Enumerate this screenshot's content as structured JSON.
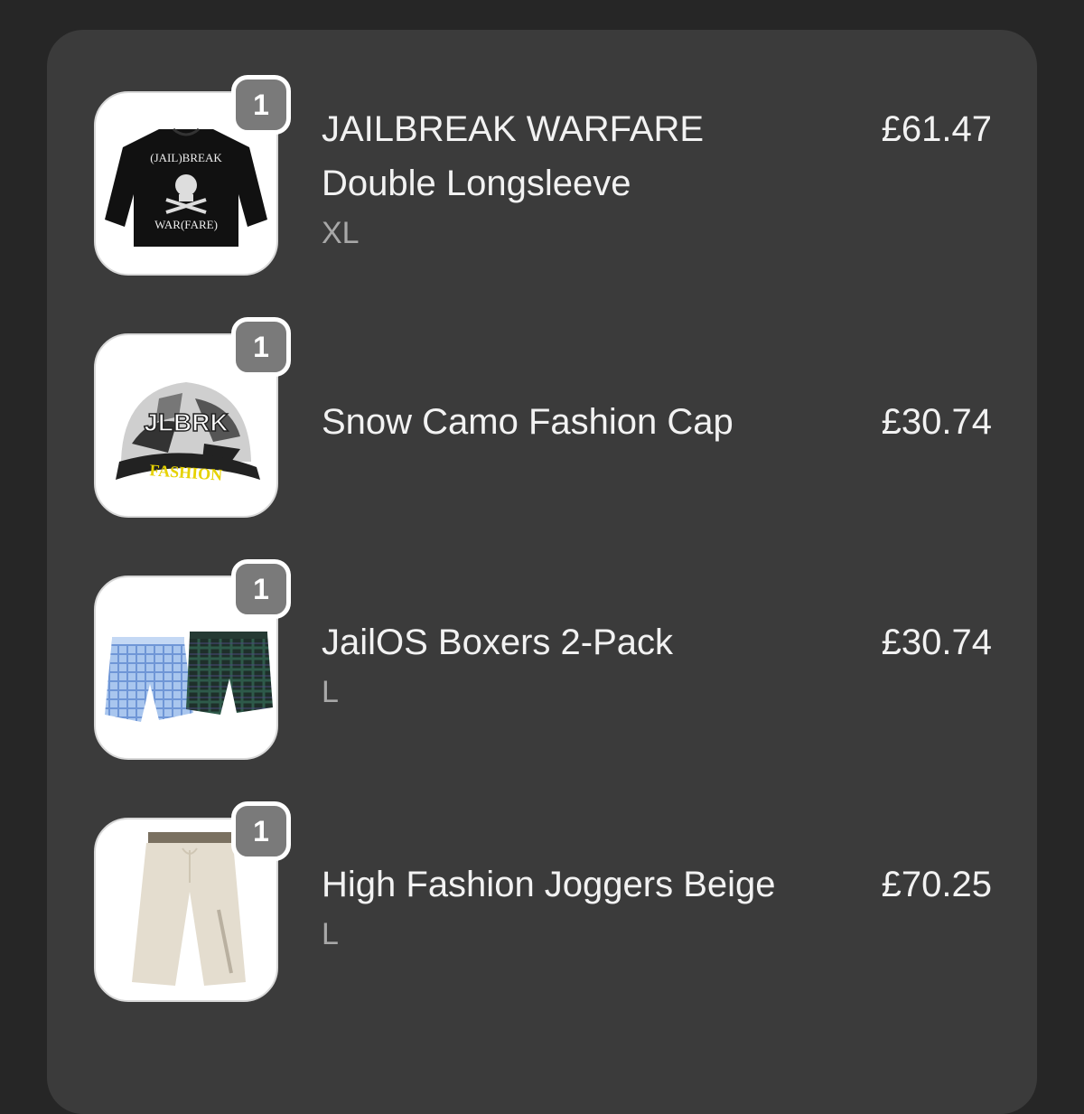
{
  "cart": {
    "items": [
      {
        "quantity": "1",
        "name_line1": "JAILBREAK WARFARE",
        "name_line2": "Double Longsleeve",
        "variant": "XL",
        "price": "£61.47",
        "image_text_top": "(JAIL)BREAK",
        "image_text_bottom": "WAR(FARE)",
        "image": "black-longsleeve-image"
      },
      {
        "quantity": "1",
        "name_line1": "Snow Camo Fashion Cap",
        "price": "£30.74",
        "image_text_top": "JLBRK",
        "image_text_bottom": "FASHION",
        "image": "camo-cap-image"
      },
      {
        "quantity": "1",
        "name_line1": "JailOS Boxers 2-Pack",
        "variant": "L",
        "price": "£30.74",
        "image": "boxers-image"
      },
      {
        "quantity": "1",
        "name_line1": "High Fashion Joggers Beige",
        "variant": "L",
        "price": "£70.25",
        "image": "beige-joggers-image"
      }
    ]
  }
}
